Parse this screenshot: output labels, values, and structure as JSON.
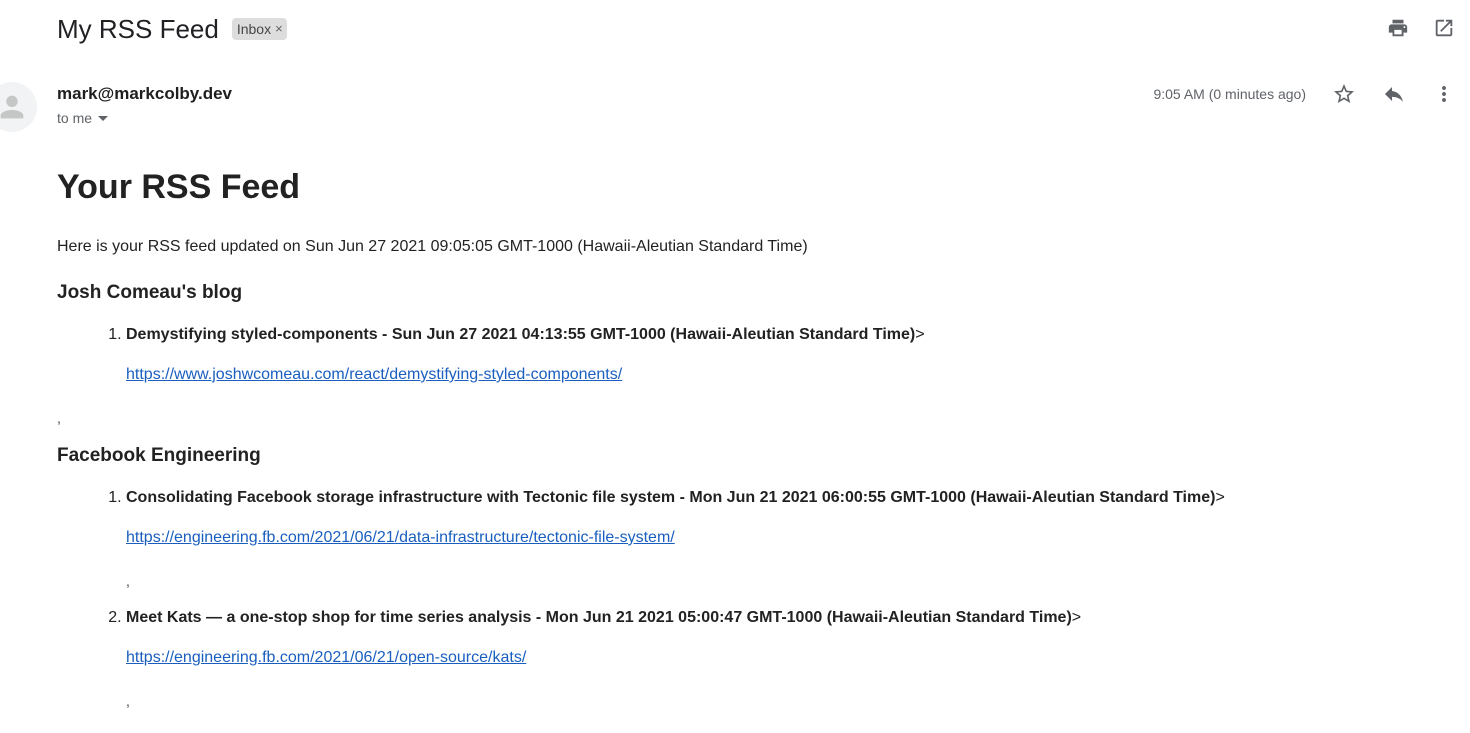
{
  "subject": {
    "title": "My RSS Feed",
    "label": "Inbox",
    "label_remove": "×"
  },
  "header_actions": {
    "icons": [
      "print-icon",
      "open-in-new-window-icon"
    ]
  },
  "message": {
    "sender": "mark@markcolby.dev",
    "recipient": "to me",
    "timestamp": "9:05 AM (0 minutes ago)",
    "actions": [
      "star-icon",
      "reply-icon",
      "more-vert-icon"
    ]
  },
  "email_body": {
    "heading": "Your RSS Feed",
    "intro": "Here is your RSS feed updated on Sun Jun 27 2021 09:05:05 GMT-1000 (Hawaii-Aleutian Standard Time)",
    "feeds": [
      {
        "name": "Josh Comeau's blog",
        "items": [
          {
            "number": "1.",
            "title": "Demystifying styled-components - Sun Jun 27 2021 04:13:55 GMT-1000 (Hawaii-Aleutian Standard Time)",
            "suffix": ">",
            "url": "https://www.joshwcomeau.com/react/demystifying-styled-components/"
          }
        ],
        "trailing": ","
      },
      {
        "name": "Facebook Engineering",
        "items": [
          {
            "number": "1.",
            "title": "Consolidating Facebook storage infrastructure with Tectonic file system - Mon Jun 21 2021 06:00:55 GMT-1000 (Hawaii-Aleutian Standard Time)",
            "suffix": ">",
            "url": "https://engineering.fb.com/2021/06/21/data-infrastructure/tectonic-file-system/",
            "trailing": ","
          },
          {
            "number": "2.",
            "title": "Meet Kats — a one-stop shop for time series analysis - Mon Jun 21 2021 05:00:47 GMT-1000 (Hawaii-Aleutian Standard Time)",
            "suffix": ">",
            "url": "https://engineering.fb.com/2021/06/21/open-source/kats/",
            "trailing": ","
          }
        ]
      }
    ]
  },
  "colors": {
    "link": "#1a5fbf",
    "chip_bg": "#dddddd",
    "icon": "#5f6368"
  }
}
